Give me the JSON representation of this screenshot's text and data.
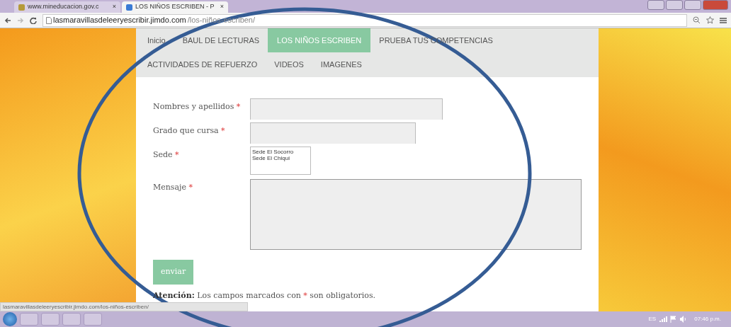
{
  "browser": {
    "tabs": [
      {
        "title": "www.mineducacion.gov.c",
        "close": "×",
        "selected": false
      },
      {
        "title": "LOS NIÑOS ESCRIBEN - P",
        "close": "×",
        "selected": true
      }
    ],
    "url_host": "lasmaravillasdeleeryescribir.jimdo.com",
    "url_path": "/los-niños-escriben/"
  },
  "nav": [
    {
      "label": "Inicio",
      "selected": false
    },
    {
      "label": "BAUL DE LECTURAS",
      "selected": false
    },
    {
      "label": "LOS NIÑOS ESCRIBEN",
      "selected": true
    },
    {
      "label": "PRUEBA TUS COMPETENCIAS",
      "selected": false
    },
    {
      "label": "ACTIVIDADES DE REFUERZO",
      "selected": false
    },
    {
      "label": "VIDEOS",
      "selected": false
    },
    {
      "label": "IMAGENES",
      "selected": false
    }
  ],
  "form": {
    "fields": [
      {
        "kind": "text",
        "label": "Nombres  y apellidos",
        "required": true
      },
      {
        "kind": "short",
        "label": "Grado que cursa",
        "required": true
      },
      {
        "kind": "list",
        "label": "Sede",
        "required": true,
        "options": [
          "Sede El Socorro",
          "Sede El Chiqui"
        ]
      },
      {
        "kind": "textarea",
        "label": "Mensaje",
        "required": true
      }
    ],
    "submit": "enviar",
    "note_bold": "Atención:",
    "note_before": "Los campos marcados con",
    "note_mark": "*",
    "note_after": "son obligatorios."
  },
  "status_url": "lasmaravillasdeleeryescribir.jimdo.com/los-niños-escriben/",
  "taskbar": {
    "language": "ES",
    "time": "07:46 p.m."
  }
}
